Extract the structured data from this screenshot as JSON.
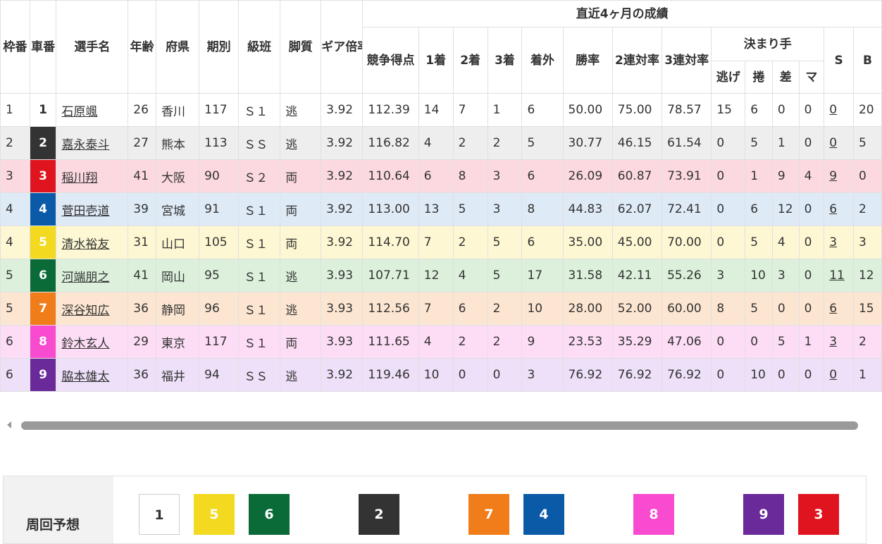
{
  "headers": {
    "waku": "枠番",
    "sha": "車番",
    "name": "選手名",
    "age": "年齢",
    "pref": "府県",
    "term": "期別",
    "class": "級班",
    "leg": "脚質",
    "gear": "ギア倍率",
    "recent": "直近4ヶ月の成績",
    "score": "競争得点",
    "first": "1着",
    "second": "2着",
    "third": "3着",
    "out": "着外",
    "winrate": "勝率",
    "top2": "2連対率",
    "top3": "3連対率",
    "kimarite": "決まり手",
    "nige": "逃げ",
    "makuri": "捲",
    "sashi": "差",
    "ma": "マ",
    "s": "S",
    "b": "B"
  },
  "car_colors": {
    "1": {
      "bg": "#ffffff",
      "fg": "#333333"
    },
    "2": {
      "bg": "#333333",
      "fg": "#ffffff"
    },
    "3": {
      "bg": "#e0141e",
      "fg": "#ffffff"
    },
    "4": {
      "bg": "#0b5aa8",
      "fg": "#ffffff"
    },
    "5": {
      "bg": "#f3da21",
      "fg": "#ffffff"
    },
    "6": {
      "bg": "#0a6b38",
      "fg": "#ffffff"
    },
    "7": {
      "bg": "#f07c1a",
      "fg": "#ffffff"
    },
    "8": {
      "bg": "#f84bd0",
      "fg": "#ffffff"
    },
    "9": {
      "bg": "#6a2a99",
      "fg": "#ffffff"
    }
  },
  "riders": [
    {
      "waku": "1",
      "car": "1",
      "name": "石原颯",
      "age": "26",
      "pref": "香川",
      "term": "117",
      "class": "Ｓ１",
      "leg": "逃",
      "gear": "3.92",
      "score": "112.39",
      "first": "14",
      "second": "7",
      "third": "1",
      "out": "6",
      "winrate": "50.00",
      "top2": "75.00",
      "top3": "78.57",
      "nige": "15",
      "makuri": "6",
      "sashi": "0",
      "ma": "0",
      "s": "0",
      "b": "20"
    },
    {
      "waku": "2",
      "car": "2",
      "name": "嘉永泰斗",
      "age": "27",
      "pref": "熊本",
      "term": "113",
      "class": "ＳＳ",
      "leg": "逃",
      "gear": "3.92",
      "score": "116.82",
      "first": "4",
      "second": "2",
      "third": "2",
      "out": "5",
      "winrate": "30.77",
      "top2": "46.15",
      "top3": "61.54",
      "nige": "0",
      "makuri": "5",
      "sashi": "1",
      "ma": "0",
      "s": "0",
      "b": "5"
    },
    {
      "waku": "3",
      "car": "3",
      "name": "稲川翔",
      "age": "41",
      "pref": "大阪",
      "term": "90",
      "class": "Ｓ２",
      "leg": "両",
      "gear": "3.92",
      "score": "110.64",
      "first": "6",
      "second": "8",
      "third": "3",
      "out": "6",
      "winrate": "26.09",
      "top2": "60.87",
      "top3": "73.91",
      "nige": "0",
      "makuri": "1",
      "sashi": "9",
      "ma": "4",
      "s": "9",
      "b": "0"
    },
    {
      "waku": "4",
      "car": "4",
      "name": "菅田壱道",
      "age": "39",
      "pref": "宮城",
      "term": "91",
      "class": "Ｓ１",
      "leg": "両",
      "gear": "3.92",
      "score": "113.00",
      "first": "13",
      "second": "5",
      "third": "3",
      "out": "8",
      "winrate": "44.83",
      "top2": "62.07",
      "top3": "72.41",
      "nige": "0",
      "makuri": "6",
      "sashi": "12",
      "ma": "0",
      "s": "6",
      "b": "2"
    },
    {
      "waku": "4",
      "car": "5",
      "name": "清水裕友",
      "age": "31",
      "pref": "山口",
      "term": "105",
      "class": "Ｓ１",
      "leg": "両",
      "gear": "3.92",
      "score": "114.70",
      "first": "7",
      "second": "2",
      "third": "5",
      "out": "6",
      "winrate": "35.00",
      "top2": "45.00",
      "top3": "70.00",
      "nige": "0",
      "makuri": "5",
      "sashi": "4",
      "ma": "0",
      "s": "3",
      "b": "3"
    },
    {
      "waku": "5",
      "car": "6",
      "name": "河端朋之",
      "age": "41",
      "pref": "岡山",
      "term": "95",
      "class": "Ｓ１",
      "leg": "逃",
      "gear": "3.93",
      "score": "107.71",
      "first": "12",
      "second": "4",
      "third": "5",
      "out": "17",
      "winrate": "31.58",
      "top2": "42.11",
      "top3": "55.26",
      "nige": "3",
      "makuri": "10",
      "sashi": "3",
      "ma": "0",
      "s": "11",
      "b": "12"
    },
    {
      "waku": "5",
      "car": "7",
      "name": "深谷知広",
      "age": "36",
      "pref": "静岡",
      "term": "96",
      "class": "Ｓ１",
      "leg": "逃",
      "gear": "3.93",
      "score": "112.56",
      "first": "7",
      "second": "6",
      "third": "2",
      "out": "10",
      "winrate": "28.00",
      "top2": "52.00",
      "top3": "60.00",
      "nige": "8",
      "makuri": "5",
      "sashi": "0",
      "ma": "0",
      "s": "6",
      "b": "15"
    },
    {
      "waku": "6",
      "car": "8",
      "name": "鈴木玄人",
      "age": "29",
      "pref": "東京",
      "term": "117",
      "class": "Ｓ１",
      "leg": "両",
      "gear": "3.93",
      "score": "111.65",
      "first": "4",
      "second": "2",
      "third": "2",
      "out": "9",
      "winrate": "23.53",
      "top2": "35.29",
      "top3": "47.06",
      "nige": "0",
      "makuri": "0",
      "sashi": "5",
      "ma": "1",
      "s": "3",
      "b": "2"
    },
    {
      "waku": "6",
      "car": "9",
      "name": "脇本雄太",
      "age": "36",
      "pref": "福井",
      "term": "94",
      "class": "ＳＳ",
      "leg": "逃",
      "gear": "3.92",
      "score": "119.46",
      "first": "10",
      "second": "0",
      "third": "0",
      "out": "3",
      "winrate": "76.92",
      "top2": "76.92",
      "top3": "76.92",
      "nige": "0",
      "makuri": "10",
      "sashi": "0",
      "ma": "0",
      "s": "0",
      "b": "1"
    }
  ],
  "prediction": {
    "label": "周回予想",
    "order": [
      "1",
      "5",
      "6",
      "2",
      "7",
      "4",
      "8",
      "9",
      "3"
    ]
  }
}
